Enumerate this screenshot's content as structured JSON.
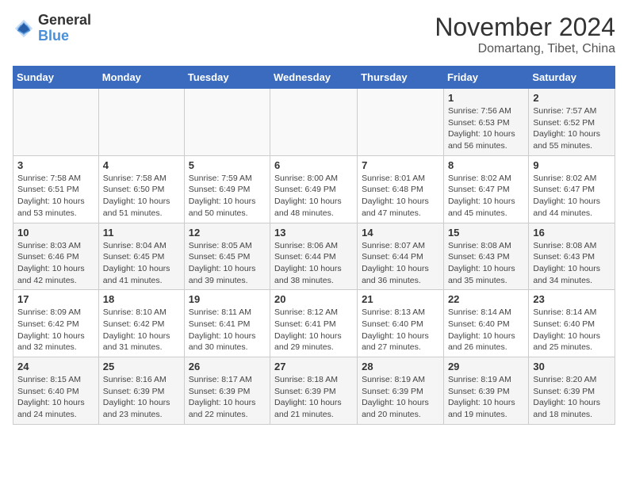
{
  "header": {
    "logo_line1": "General",
    "logo_line2": "Blue",
    "month": "November 2024",
    "location": "Domartang, Tibet, China"
  },
  "weekdays": [
    "Sunday",
    "Monday",
    "Tuesday",
    "Wednesday",
    "Thursday",
    "Friday",
    "Saturday"
  ],
  "weeks": [
    [
      {
        "day": "",
        "info": ""
      },
      {
        "day": "",
        "info": ""
      },
      {
        "day": "",
        "info": ""
      },
      {
        "day": "",
        "info": ""
      },
      {
        "day": "",
        "info": ""
      },
      {
        "day": "1",
        "info": "Sunrise: 7:56 AM\nSunset: 6:53 PM\nDaylight: 10 hours and 56 minutes."
      },
      {
        "day": "2",
        "info": "Sunrise: 7:57 AM\nSunset: 6:52 PM\nDaylight: 10 hours and 55 minutes."
      }
    ],
    [
      {
        "day": "3",
        "info": "Sunrise: 7:58 AM\nSunset: 6:51 PM\nDaylight: 10 hours and 53 minutes."
      },
      {
        "day": "4",
        "info": "Sunrise: 7:58 AM\nSunset: 6:50 PM\nDaylight: 10 hours and 51 minutes."
      },
      {
        "day": "5",
        "info": "Sunrise: 7:59 AM\nSunset: 6:49 PM\nDaylight: 10 hours and 50 minutes."
      },
      {
        "day": "6",
        "info": "Sunrise: 8:00 AM\nSunset: 6:49 PM\nDaylight: 10 hours and 48 minutes."
      },
      {
        "day": "7",
        "info": "Sunrise: 8:01 AM\nSunset: 6:48 PM\nDaylight: 10 hours and 47 minutes."
      },
      {
        "day": "8",
        "info": "Sunrise: 8:02 AM\nSunset: 6:47 PM\nDaylight: 10 hours and 45 minutes."
      },
      {
        "day": "9",
        "info": "Sunrise: 8:02 AM\nSunset: 6:47 PM\nDaylight: 10 hours and 44 minutes."
      }
    ],
    [
      {
        "day": "10",
        "info": "Sunrise: 8:03 AM\nSunset: 6:46 PM\nDaylight: 10 hours and 42 minutes."
      },
      {
        "day": "11",
        "info": "Sunrise: 8:04 AM\nSunset: 6:45 PM\nDaylight: 10 hours and 41 minutes."
      },
      {
        "day": "12",
        "info": "Sunrise: 8:05 AM\nSunset: 6:45 PM\nDaylight: 10 hours and 39 minutes."
      },
      {
        "day": "13",
        "info": "Sunrise: 8:06 AM\nSunset: 6:44 PM\nDaylight: 10 hours and 38 minutes."
      },
      {
        "day": "14",
        "info": "Sunrise: 8:07 AM\nSunset: 6:44 PM\nDaylight: 10 hours and 36 minutes."
      },
      {
        "day": "15",
        "info": "Sunrise: 8:08 AM\nSunset: 6:43 PM\nDaylight: 10 hours and 35 minutes."
      },
      {
        "day": "16",
        "info": "Sunrise: 8:08 AM\nSunset: 6:43 PM\nDaylight: 10 hours and 34 minutes."
      }
    ],
    [
      {
        "day": "17",
        "info": "Sunrise: 8:09 AM\nSunset: 6:42 PM\nDaylight: 10 hours and 32 minutes."
      },
      {
        "day": "18",
        "info": "Sunrise: 8:10 AM\nSunset: 6:42 PM\nDaylight: 10 hours and 31 minutes."
      },
      {
        "day": "19",
        "info": "Sunrise: 8:11 AM\nSunset: 6:41 PM\nDaylight: 10 hours and 30 minutes."
      },
      {
        "day": "20",
        "info": "Sunrise: 8:12 AM\nSunset: 6:41 PM\nDaylight: 10 hours and 29 minutes."
      },
      {
        "day": "21",
        "info": "Sunrise: 8:13 AM\nSunset: 6:40 PM\nDaylight: 10 hours and 27 minutes."
      },
      {
        "day": "22",
        "info": "Sunrise: 8:14 AM\nSunset: 6:40 PM\nDaylight: 10 hours and 26 minutes."
      },
      {
        "day": "23",
        "info": "Sunrise: 8:14 AM\nSunset: 6:40 PM\nDaylight: 10 hours and 25 minutes."
      }
    ],
    [
      {
        "day": "24",
        "info": "Sunrise: 8:15 AM\nSunset: 6:40 PM\nDaylight: 10 hours and 24 minutes."
      },
      {
        "day": "25",
        "info": "Sunrise: 8:16 AM\nSunset: 6:39 PM\nDaylight: 10 hours and 23 minutes."
      },
      {
        "day": "26",
        "info": "Sunrise: 8:17 AM\nSunset: 6:39 PM\nDaylight: 10 hours and 22 minutes."
      },
      {
        "day": "27",
        "info": "Sunrise: 8:18 AM\nSunset: 6:39 PM\nDaylight: 10 hours and 21 minutes."
      },
      {
        "day": "28",
        "info": "Sunrise: 8:19 AM\nSunset: 6:39 PM\nDaylight: 10 hours and 20 minutes."
      },
      {
        "day": "29",
        "info": "Sunrise: 8:19 AM\nSunset: 6:39 PM\nDaylight: 10 hours and 19 minutes."
      },
      {
        "day": "30",
        "info": "Sunrise: 8:20 AM\nSunset: 6:39 PM\nDaylight: 10 hours and 18 minutes."
      }
    ]
  ]
}
